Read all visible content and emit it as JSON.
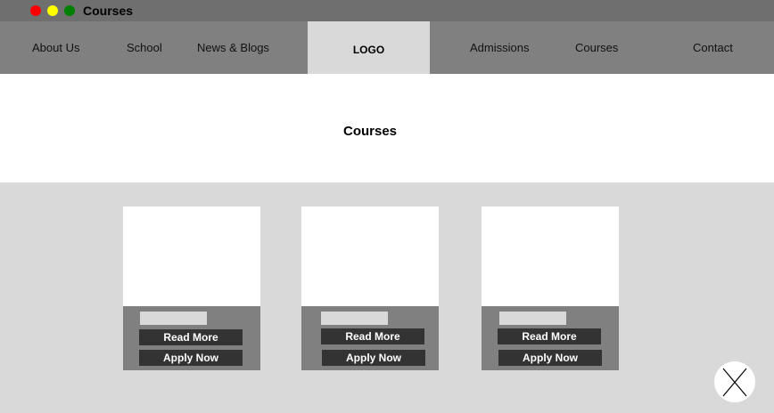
{
  "window": {
    "title": "Courses"
  },
  "nav": {
    "left": [
      "About Us",
      "School",
      "News & Blogs"
    ],
    "logo": "LOGO",
    "right": [
      "Admissions",
      "Courses",
      "Contact"
    ]
  },
  "hero": {
    "title": "Courses"
  },
  "cards": [
    {
      "read_more": "Read More",
      "apply_now": "Apply Now"
    },
    {
      "read_more": "Read More",
      "apply_now": "Apply Now"
    },
    {
      "read_more": "Read More",
      "apply_now": "Apply Now"
    }
  ],
  "colors": {
    "titlebar": "#6f6f6f",
    "navbar": "#808080",
    "background": "#d9d9d9",
    "button": "#333333"
  }
}
